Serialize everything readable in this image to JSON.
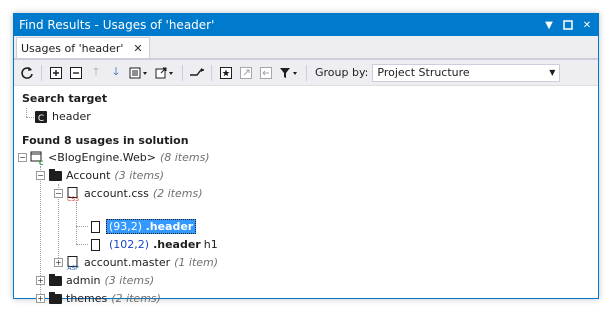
{
  "window": {
    "title": "Find Results - Usages of 'header'",
    "tab_label": "Usages of 'header'",
    "close_glyph": "✕"
  },
  "toolbar": {
    "group_by_label": "Group by:",
    "group_by_value": "Project Structure"
  },
  "search_target": {
    "heading": "Search target",
    "item": "header"
  },
  "found": {
    "heading": "Found 8 usages in solution"
  },
  "tree": {
    "solution": {
      "label": "<BlogEngine.Web>",
      "count": "(8 items)"
    },
    "account": {
      "label": "Account",
      "count": "(3 items)"
    },
    "account_css": {
      "label": "account.css",
      "count": "(2 items)"
    },
    "usage1": {
      "location": "(93,2)",
      "text": ".header",
      "suffix": ""
    },
    "usage2": {
      "location": "(102,2)",
      "text": ".header",
      "suffix": "h1"
    },
    "account_master": {
      "label": "account.master",
      "count": "(1 item)"
    },
    "admin": {
      "label": "admin",
      "count": "(3 items)"
    },
    "themes": {
      "label": "themes",
      "count": "(2 items)"
    }
  },
  "colors": {
    "accent": "#007acc",
    "selection": "#3399ff",
    "location_text": "#1a47c8"
  }
}
